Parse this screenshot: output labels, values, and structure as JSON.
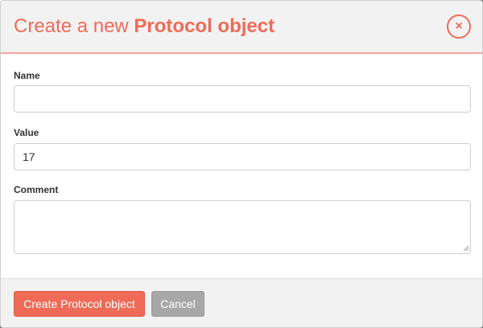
{
  "dialog": {
    "title_prefix": "Create a new ",
    "title_object": "Protocol object",
    "close_label": "×"
  },
  "form": {
    "name": {
      "label": "Name",
      "value": "",
      "placeholder": ""
    },
    "value": {
      "label": "Value",
      "value": "17",
      "placeholder": ""
    },
    "comment": {
      "label": "Comment",
      "value": "",
      "placeholder": ""
    }
  },
  "footer": {
    "create_label": "Create Protocol object",
    "cancel_label": "Cancel"
  },
  "colors": {
    "accent": "#ef6b57",
    "header_border": "#f3a69b",
    "cancel_bg": "#a7a7a7",
    "panel_bg": "#f2f2f2"
  },
  "icons": {
    "close": "close-icon",
    "resize": "resize-grip-icon"
  }
}
